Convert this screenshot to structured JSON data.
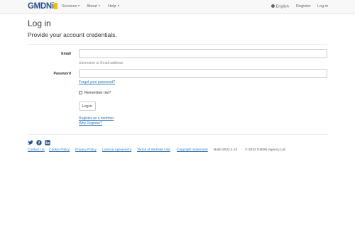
{
  "nav": {
    "brand": "GMDN",
    "brand_suffix": "i",
    "services": "Services",
    "about": "About",
    "help": "Help",
    "language": "English",
    "register": "Register",
    "login": "Log in"
  },
  "page": {
    "title": "Log in",
    "subtitle": "Provide your account credentials."
  },
  "form": {
    "email_label": "Email",
    "email_value": "",
    "email_help": "Username or Email address",
    "password_label": "Password",
    "password_value": "",
    "forgot_link": "Forgot your password?",
    "remember_label": "Remember me?",
    "remember_checked": false,
    "submit_label": "Log in",
    "register_link": "Register as a member",
    "why_register_link": "Why Register?"
  },
  "footer": {
    "links": [
      "Contact Us",
      "Cookie Policy",
      "Privacy Policy",
      "Licence Agreement",
      "Terms of Website Use",
      "Copyright Statement"
    ],
    "build": "Build 2022.4.13",
    "copyright": "© 2022 GMDN Agency Ltd."
  },
  "colors": {
    "brand": "#1f4e8c",
    "brand_accent": "#f2c200",
    "link": "#337ab7",
    "navbar_bg": "#f8f8f8"
  },
  "icons": {
    "social": [
      "twitter-icon",
      "facebook-icon",
      "linkedin-icon"
    ],
    "language": "globe-icon"
  }
}
